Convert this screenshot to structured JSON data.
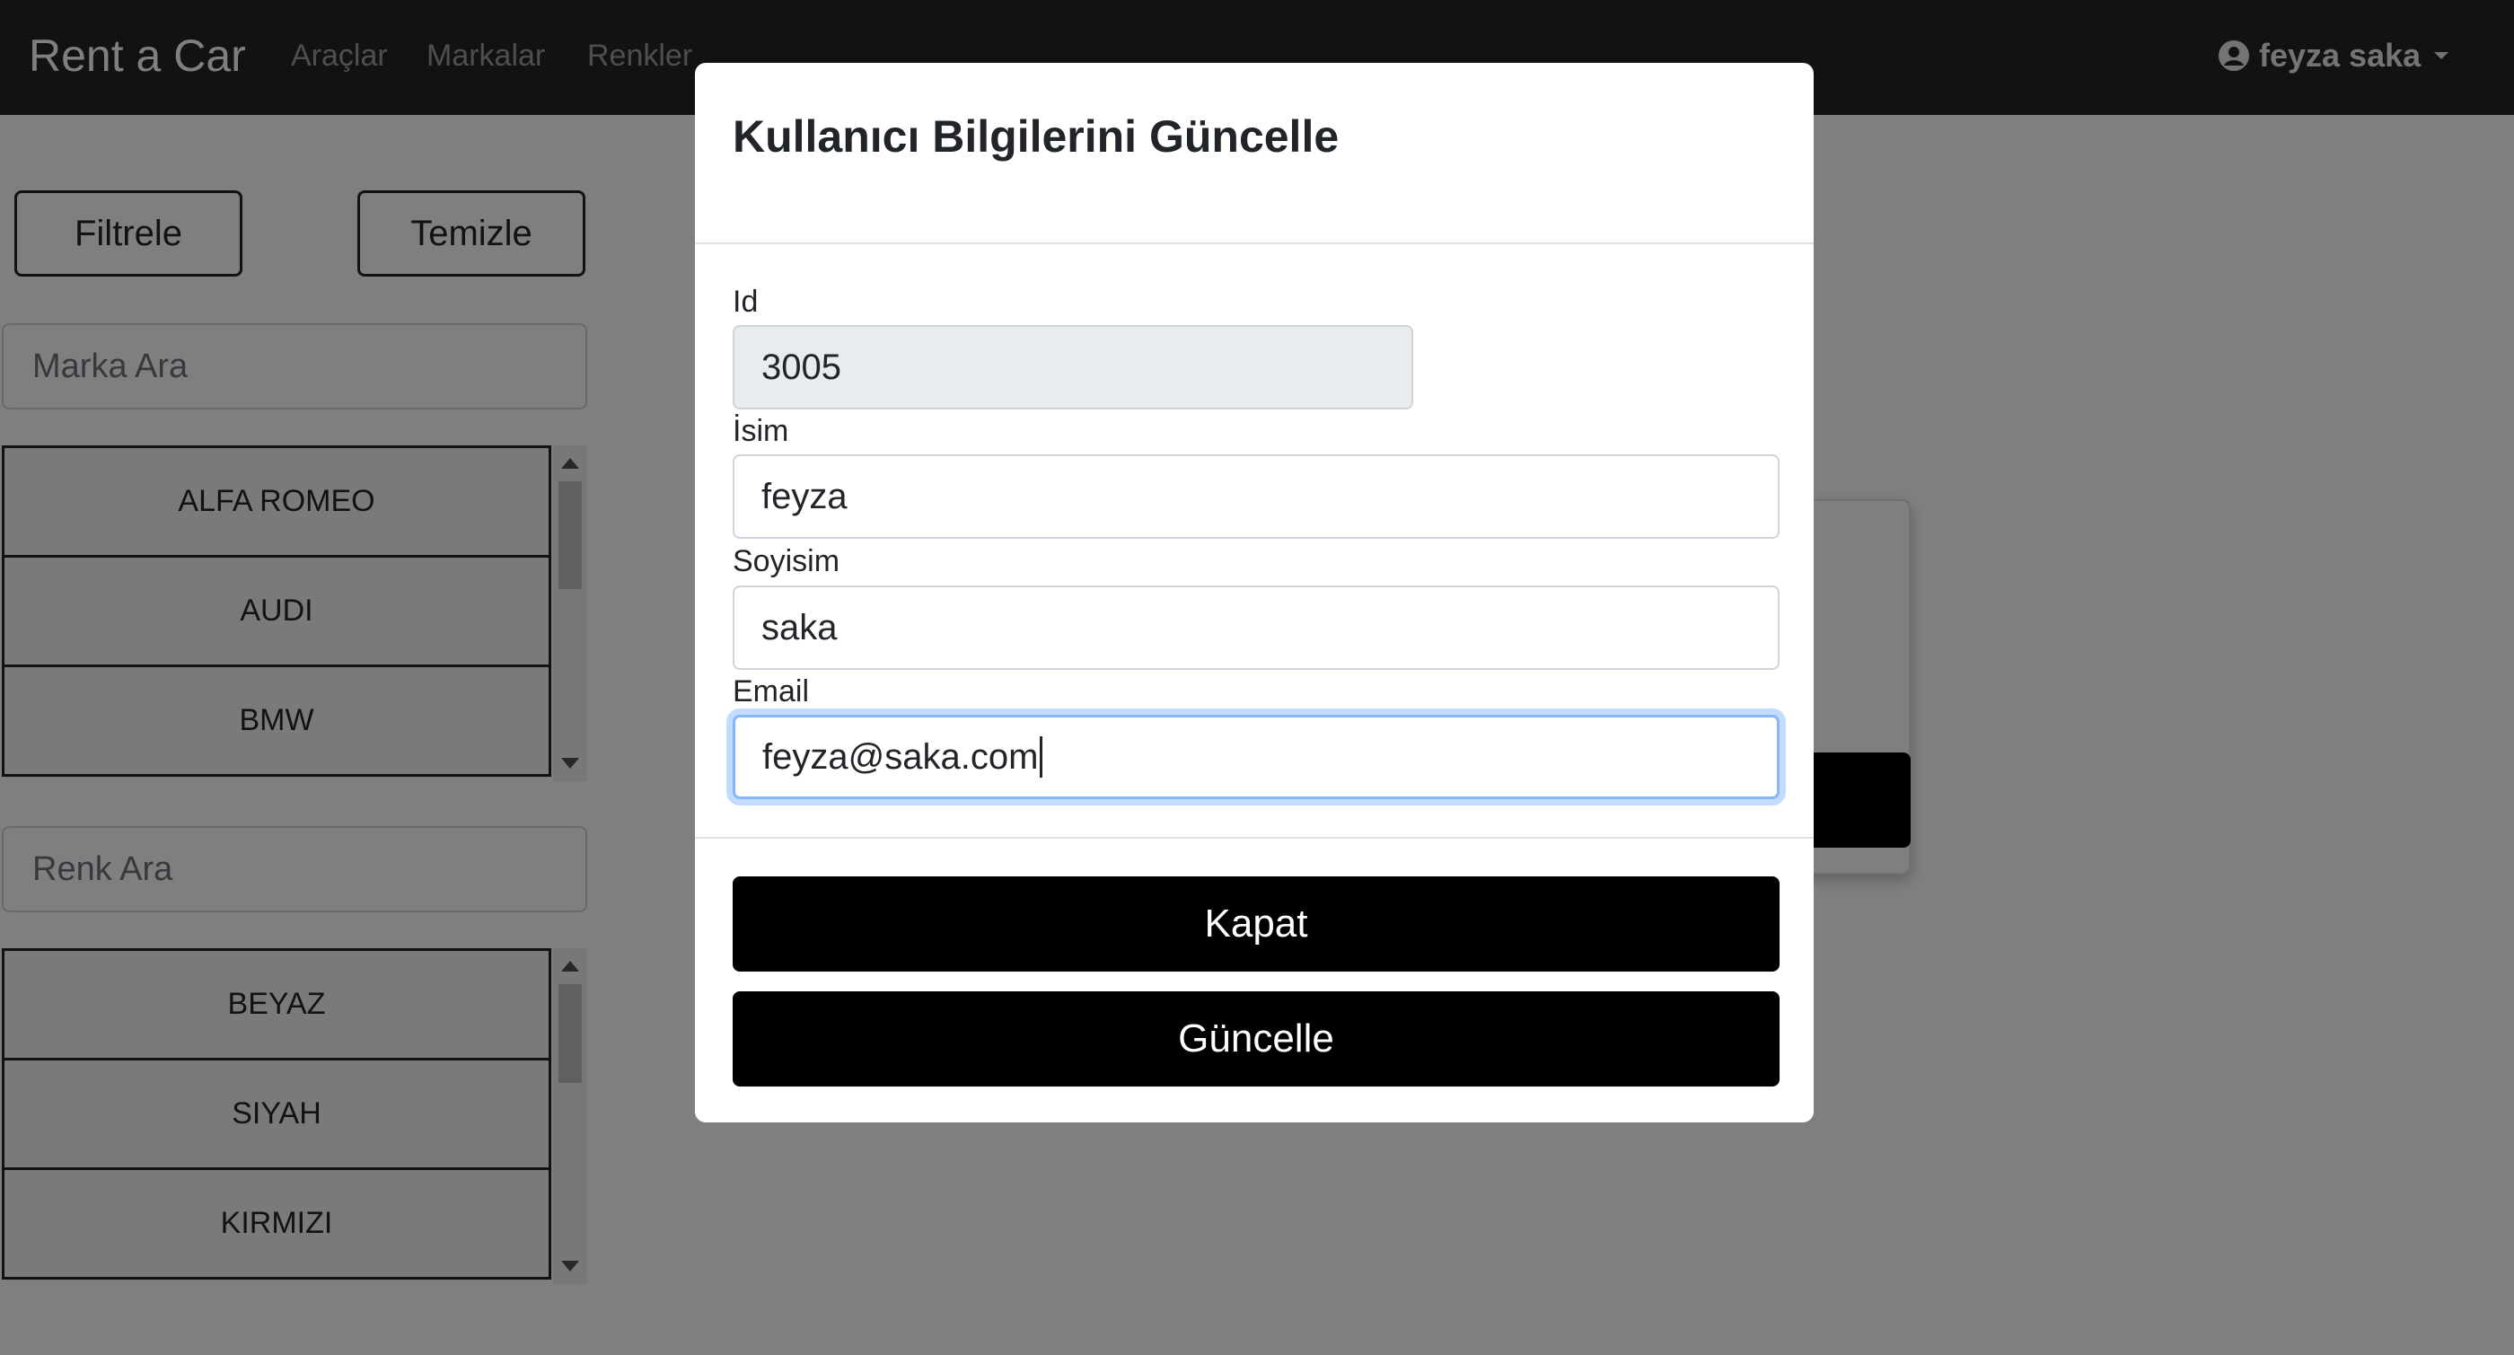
{
  "navbar": {
    "brand": "Rent a Car",
    "links": [
      "Araçlar",
      "Markalar",
      "Renkler"
    ],
    "user_name": "feyza saka"
  },
  "filters": {
    "filter_button": "Filtrele",
    "clear_button": "Temizle",
    "brand_search_placeholder": "Marka Ara",
    "brands": [
      "ALFA ROMEO",
      "AUDI",
      "BMW"
    ],
    "color_search_placeholder": "Renk Ara",
    "colors": [
      "BEYAZ",
      "SIYAH",
      "KIRMIZI"
    ]
  },
  "modal": {
    "title": "Kullanıcı Bilgilerini Güncelle",
    "fields": {
      "id_label": "Id",
      "id_value": "3005",
      "name_label": "İsim",
      "name_value": "feyza",
      "surname_label": "Soyisim",
      "surname_value": "saka",
      "email_label": "Email",
      "email_value": "feyza@saka.com"
    },
    "close_button": "Kapat",
    "update_button": "Güncelle"
  },
  "colors": {
    "navbar_bg": "#212529",
    "button_black": "#000000",
    "focus_ring": "#86b7fe"
  },
  "icons": {
    "user": "user-circle-icon",
    "dropdown": "caret-down-icon"
  }
}
